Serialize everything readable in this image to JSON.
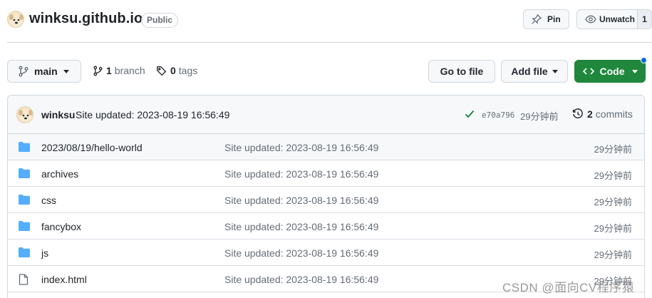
{
  "repo": {
    "name": "winksu.github.io",
    "visibility": "Public",
    "pin_label": "Pin",
    "watch_label": "Unwatch",
    "watch_count": "1"
  },
  "toolbar": {
    "branch": "main",
    "branch_count": "1",
    "branch_word": "branch",
    "tag_count": "0",
    "tag_word": "tags",
    "goto_label": "Go to file",
    "add_label": "Add file",
    "code_label": "Code"
  },
  "commit": {
    "author": "winksu",
    "message": "Site updated: 2023-08-19 16:56:49",
    "sha": "e70a796",
    "time": "29分钟前",
    "count": "2",
    "count_word": "commits"
  },
  "files": [
    {
      "name": "2023/08/19/hello-world",
      "type": "folder",
      "message": "Site updated: 2023-08-19 16:56:49",
      "time": "29分钟前"
    },
    {
      "name": "archives",
      "type": "folder",
      "message": "Site updated: 2023-08-19 16:56:49",
      "time": "29分钟前"
    },
    {
      "name": "css",
      "type": "folder",
      "message": "Site updated: 2023-08-19 16:56:49",
      "time": "29分钟前"
    },
    {
      "name": "fancybox",
      "type": "folder",
      "message": "Site updated: 2023-08-19 16:56:49",
      "time": "29分钟前"
    },
    {
      "name": "js",
      "type": "folder",
      "message": "Site updated: 2023-08-19 16:56:49",
      "time": "29分钟前"
    },
    {
      "name": "index.html",
      "type": "file",
      "message": "Site updated: 2023-08-19 16:56:49",
      "time": "29分钟前"
    }
  ],
  "watermark": "CSDN @面向CV程序猿",
  "colors": {
    "accent_green": "#1f883d",
    "folder_blue": "#54aeff",
    "link_blue": "#0969da",
    "muted_text": "#656d76"
  }
}
